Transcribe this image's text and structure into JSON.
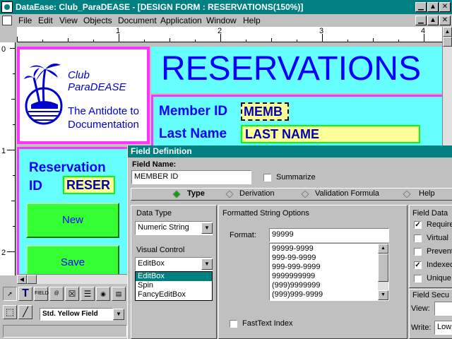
{
  "window": {
    "title": "DataEase: Club_ParaDEASE - [DESIGN FORM : RESERVATIONS(150%)]"
  },
  "menu": {
    "items": [
      "File",
      "Edit",
      "View",
      "Objects",
      "Document",
      "Application",
      "Window",
      "Help"
    ]
  },
  "ruler": {
    "h_marks": [
      "1",
      "2",
      "3",
      "4"
    ],
    "v_marks": [
      "0",
      "1",
      "2"
    ]
  },
  "form": {
    "logo": {
      "name_line1": "Club",
      "name_line2": "ParaDEASE",
      "tag_line1": "The Antidote to",
      "tag_line2": "Documentation"
    },
    "title": "RESERVATIONS",
    "member_id_label": "Member ID",
    "member_id_field": "MEMB",
    "last_name_label": "Last Name",
    "last_name_field": "LAST NAME",
    "reservation_label_1": "Reservation",
    "reservation_label_2": "ID",
    "reservation_field": "RESER",
    "buttons": [
      "New",
      "Save"
    ]
  },
  "toolbar": {
    "style_value": "Std. Yellow Field"
  },
  "dialog": {
    "title": "Field Definition",
    "field_name_label": "Field Name:",
    "field_name_value": "MEMBER ID",
    "summarize_label": "Summarize",
    "tabs": [
      "Type",
      "Derivation",
      "Validation Formula",
      "Help"
    ],
    "data_type_label": "Data Type",
    "data_type_value": "Numeric String",
    "visual_control_label": "Visual Control",
    "visual_control_value": "EditBox",
    "visual_control_options": [
      "EditBox",
      "Spin",
      "FancyEditBox"
    ],
    "formatted_group_label": "Formatted String Options",
    "format_label": "Format:",
    "format_value": "99999",
    "format_list": [
      "99999-9999",
      "999-99-9999",
      "999-999-9999",
      "9999999999",
      "(999)9999999",
      "(999)999-9999"
    ],
    "fasttext_label": "FastText Index",
    "field_data_label": "Field Data",
    "field_data_options": [
      {
        "label": "Required",
        "checked": true
      },
      {
        "label": "Virtual",
        "checked": false
      },
      {
        "label": "Prevent",
        "checked": false
      },
      {
        "label": "Indexed",
        "checked": true
      },
      {
        "label": "Unique",
        "checked": false
      }
    ],
    "security_label": "Field Secu",
    "view_label": "View:",
    "write_label": "Write:",
    "write_value": "Low"
  }
}
